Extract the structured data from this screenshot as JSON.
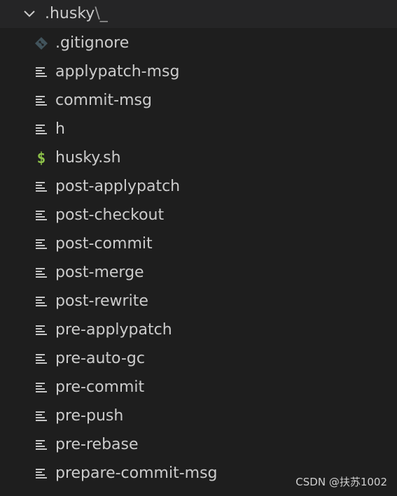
{
  "folder": {
    "name": ".husky",
    "suffix": "\\_",
    "expanded_icon": "chevron-down-icon"
  },
  "files": [
    {
      "name": ".gitignore",
      "icon": "git-icon"
    },
    {
      "name": "applypatch-msg",
      "icon": "text-file-icon"
    },
    {
      "name": "commit-msg",
      "icon": "text-file-icon"
    },
    {
      "name": "h",
      "icon": "text-file-icon"
    },
    {
      "name": "husky.sh",
      "icon": "shell-script-icon"
    },
    {
      "name": "post-applypatch",
      "icon": "text-file-icon"
    },
    {
      "name": "post-checkout",
      "icon": "text-file-icon"
    },
    {
      "name": "post-commit",
      "icon": "text-file-icon"
    },
    {
      "name": "post-merge",
      "icon": "text-file-icon"
    },
    {
      "name": "post-rewrite",
      "icon": "text-file-icon"
    },
    {
      "name": "pre-applypatch",
      "icon": "text-file-icon"
    },
    {
      "name": "pre-auto-gc",
      "icon": "text-file-icon"
    },
    {
      "name": "pre-commit",
      "icon": "text-file-icon"
    },
    {
      "name": "pre-push",
      "icon": "text-file-icon"
    },
    {
      "name": "pre-rebase",
      "icon": "text-file-icon"
    },
    {
      "name": "prepare-commit-msg",
      "icon": "text-file-icon"
    }
  ],
  "colors": {
    "background": "#1e1e1e",
    "folder_row": "#252526",
    "text": "#cccccc",
    "text_icon": "#c5c5c5",
    "shell_icon": "#8dc149",
    "git_icon": "#41535b"
  },
  "watermark": "CSDN @扶苏1002"
}
